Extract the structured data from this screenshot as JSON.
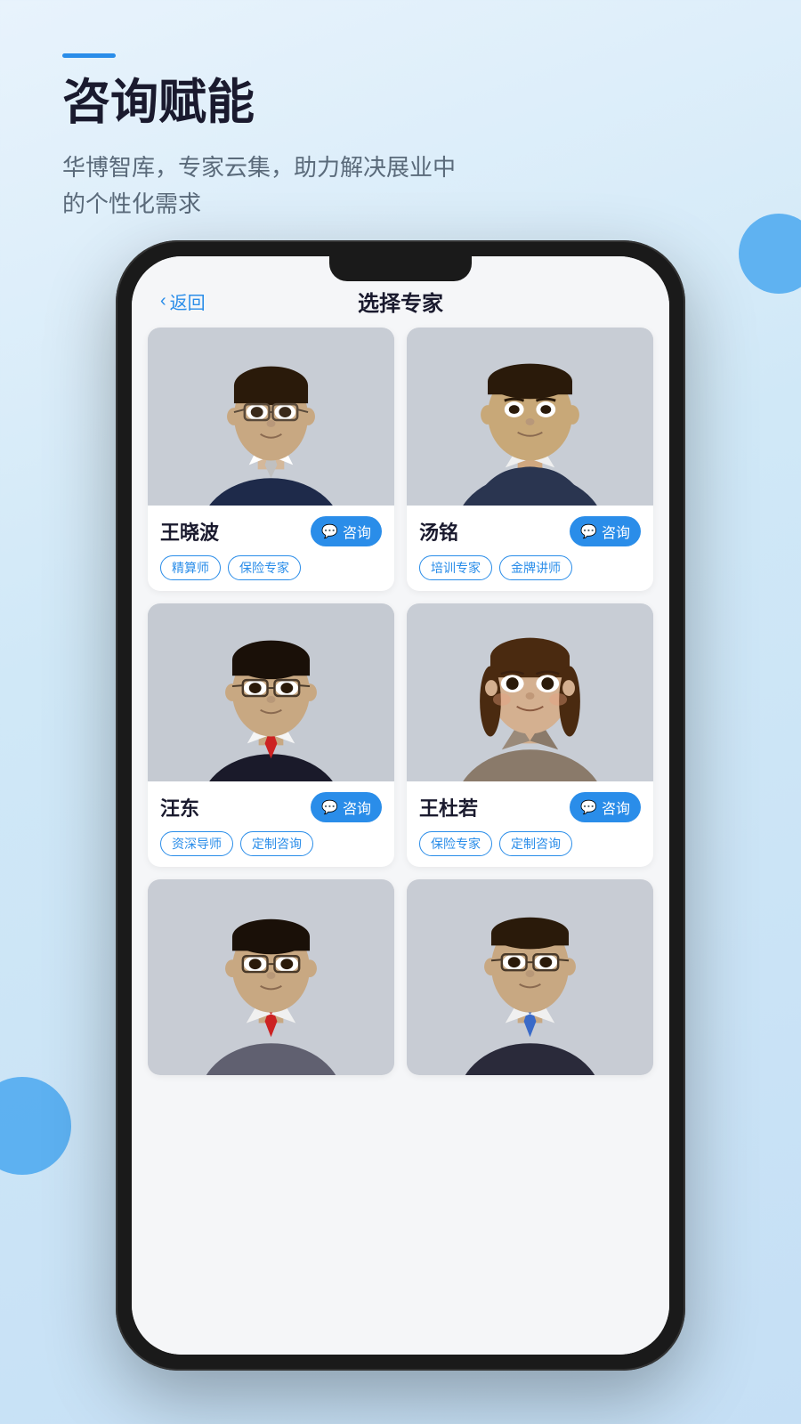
{
  "page": {
    "background": "linear-gradient(160deg, #e8f3fc 0%, #d0e8f7 40%, #c5dff5 100%)"
  },
  "header": {
    "accent_line": true,
    "title": "咨询赋能",
    "subtitle": "华博智库，专家云集，助力解决展业中\n的个性化需求"
  },
  "nav": {
    "back_label": "返回",
    "page_title": "选择专家"
  },
  "experts": [
    {
      "id": 1,
      "name": "王晓波",
      "consult_label": "咨询",
      "tags": [
        "精算师",
        "保险专家"
      ],
      "photo_bg": "#c8cdd5"
    },
    {
      "id": 2,
      "name": "汤铭",
      "consult_label": "咨询",
      "tags": [
        "培训专家",
        "金牌讲师"
      ],
      "photo_bg": "#c8cdd5"
    },
    {
      "id": 3,
      "name": "汪东",
      "consult_label": "咨询",
      "tags": [
        "资深导师",
        "定制咨询"
      ],
      "photo_bg": "#c5cad2"
    },
    {
      "id": 4,
      "name": "王杜若",
      "consult_label": "咨询",
      "tags": [
        "保险专家",
        "定制咨询"
      ],
      "photo_bg": "#c8cdd5"
    },
    {
      "id": 5,
      "name": "",
      "consult_label": "",
      "tags": [],
      "photo_bg": "#c8ccd4"
    },
    {
      "id": 6,
      "name": "",
      "consult_label": "",
      "tags": [],
      "photo_bg": "#c8ccd4"
    }
  ],
  "colors": {
    "accent": "#2a8de9",
    "dark": "#1a1a2e",
    "subtitle": "#5a6a7a",
    "tag_border": "#2a8de9",
    "tag_text": "#2a8de9",
    "card_bg": "#ffffff",
    "screen_bg": "#f5f6f8"
  }
}
